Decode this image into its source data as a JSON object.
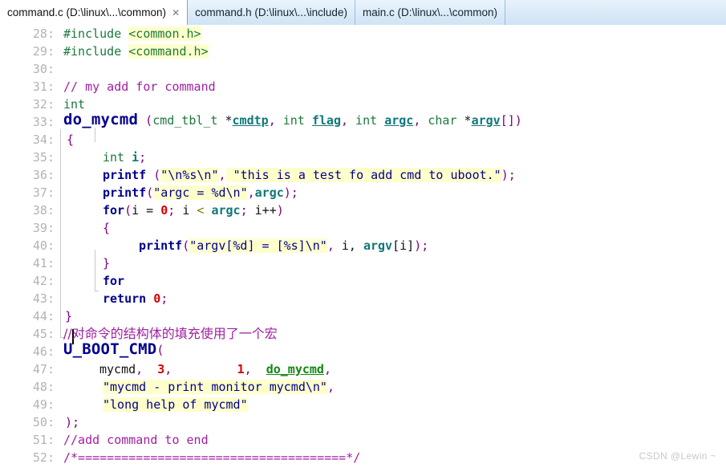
{
  "window": {
    "title": "command.c (D:\\linux\\...\\common)"
  },
  "tabs": [
    {
      "label": "command.c (D:\\linux\\...\\common)",
      "active": true,
      "close_icon": "✕"
    },
    {
      "label": "command.h (D:\\linux\\...\\include)",
      "active": false,
      "close_icon": ""
    },
    {
      "label": "main.c (D:\\linux\\...\\common)",
      "active": false,
      "close_icon": ""
    }
  ],
  "editor": {
    "first_line_number": 28,
    "last_line_number": 52,
    "language": "C",
    "lines": [
      {
        "no": "28:",
        "text": "#include <common.h>"
      },
      {
        "no": "29:",
        "text": "#include <command.h>"
      },
      {
        "no": "30:",
        "text": ""
      },
      {
        "no": "31:",
        "text": "// my add for command"
      },
      {
        "no": "32:",
        "text": "int"
      },
      {
        "no": "33:",
        "text": "do_mycmd (cmd_tbl_t *cmdtp, int flag, int argc, char *argv[])"
      },
      {
        "no": "34:",
        "text": "{"
      },
      {
        "no": "35:",
        "text": "    int i;"
      },
      {
        "no": "36:",
        "text": "    printf (\"\\n%s\\n\", \"this is a test fo add cmd to uboot.\");"
      },
      {
        "no": "37:",
        "text": "    printf(\"argc = %d\\n\",argc);"
      },
      {
        "no": "38:",
        "text": "    for(i = 0; i < argc; i++)"
      },
      {
        "no": "39:",
        "text": "    {"
      },
      {
        "no": "40:",
        "text": "        printf(\"argv[%d] = [%s]\\n\", i, argv[i]);"
      },
      {
        "no": "41:",
        "text": "    }"
      },
      {
        "no": "42:",
        "text": "    for"
      },
      {
        "no": "43:",
        "text": "    return 0;"
      },
      {
        "no": "44:",
        "text": "}"
      },
      {
        "no": "45:",
        "text": "//对命令的结构体的填充使用了一个宏"
      },
      {
        "no": "46:",
        "text": "U_BOOT_CMD("
      },
      {
        "no": "47:",
        "text": "    mycmd,  3,         1,  do_mycmd,"
      },
      {
        "no": "48:",
        "text": "    \"mycmd - print monitor mycmd\\n\","
      },
      {
        "no": "49:",
        "text": "    \"long help of mycmd\""
      },
      {
        "no": "50:",
        "text": ");"
      },
      {
        "no": "51:",
        "text": "//add command to end"
      },
      {
        "no": "52:",
        "text": "/*=====================================*/"
      }
    ],
    "highlighted_strings": [
      "<common.h>",
      "<command.h>",
      "\"\\n%s\\n\"",
      "\"this is a test fo add cmd to uboot.\"",
      "\"argc = %d\\n\"",
      "\"argv[%d] = [%s]\\n\"",
      "\"mycmd - print monitor mycmd\\n\"",
      "\"long help of mycmd\""
    ]
  },
  "colors": {
    "keyword": "#00008b",
    "type": "#1a7a3c",
    "string": "#00008b",
    "comment": "#a020a0",
    "number": "#d00000",
    "variable": "#107878",
    "highlight": "#ffffcc",
    "line_number": "#b3b3b3",
    "tab_active_bg": "#ffffff",
    "tab_bar_bg": "#dbeaf8"
  },
  "watermark": {
    "text": "CSDN @Lewin ~"
  }
}
